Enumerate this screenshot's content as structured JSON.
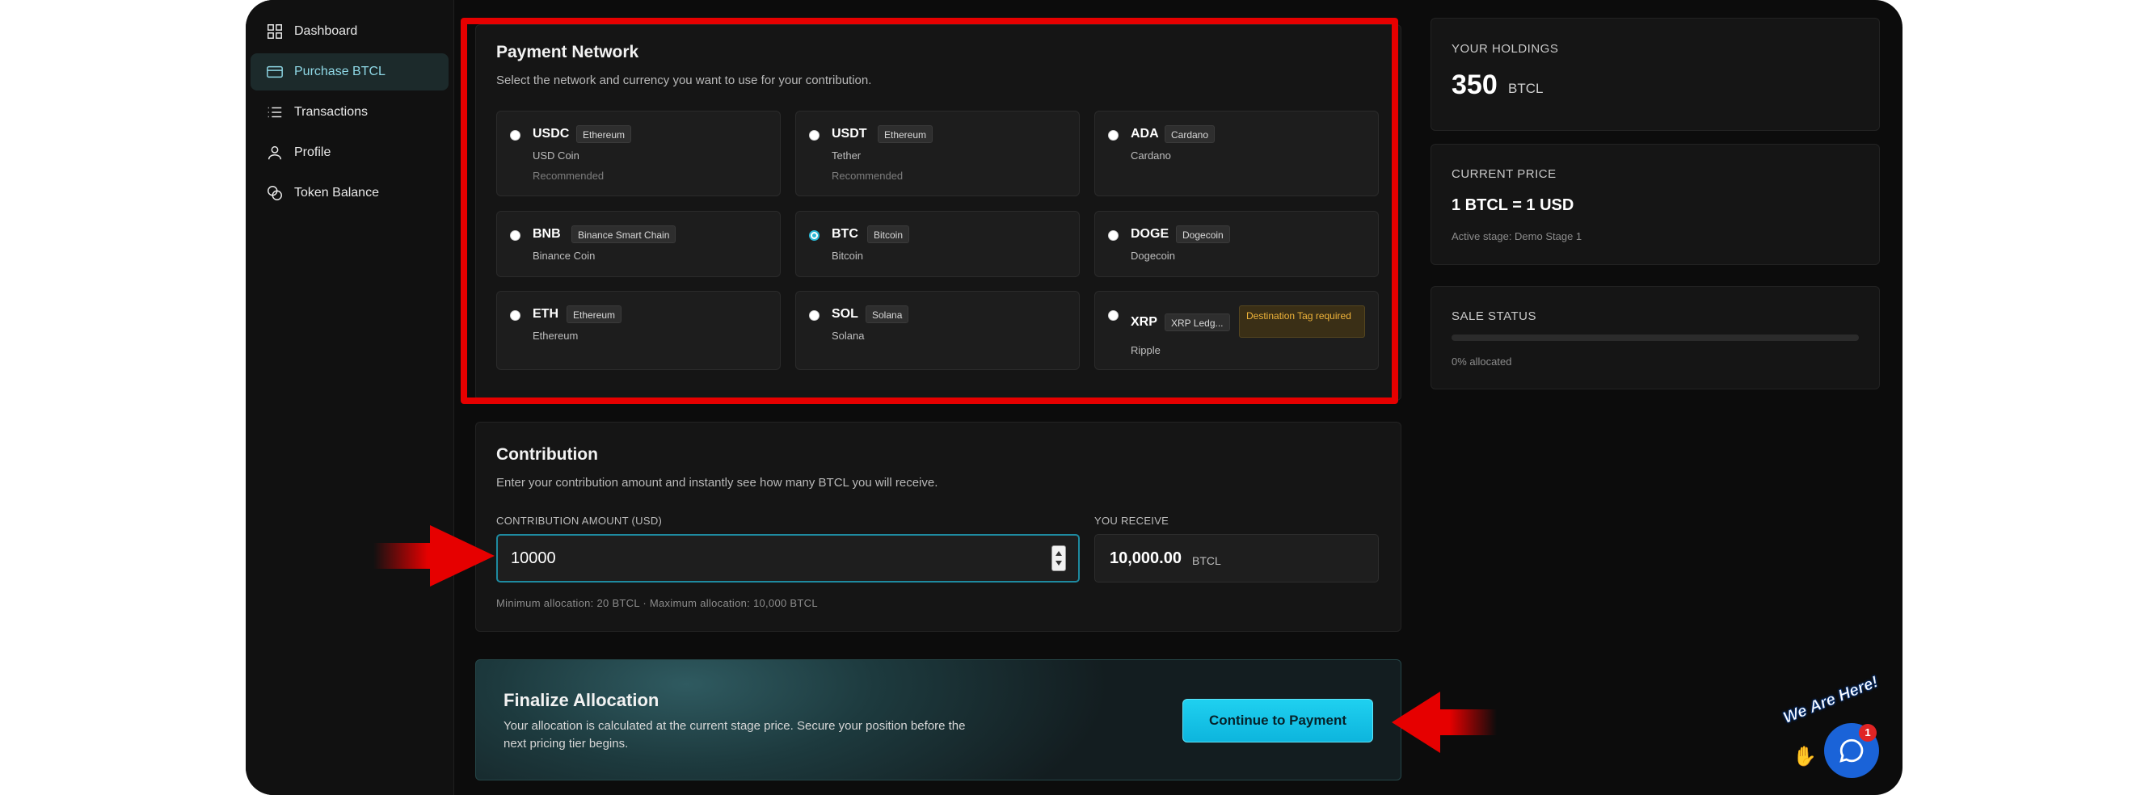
{
  "sidebar": {
    "items": [
      {
        "label": "Dashboard",
        "icon": "grid-icon",
        "active": false
      },
      {
        "label": "Purchase BTCL",
        "icon": "card-icon",
        "active": true
      },
      {
        "label": "Transactions",
        "icon": "list-icon",
        "active": false
      },
      {
        "label": "Profile",
        "icon": "user-icon",
        "active": false
      },
      {
        "label": "Token Balance",
        "icon": "coins-icon",
        "active": false
      }
    ]
  },
  "payment_network": {
    "title": "Payment Network",
    "subtitle": "Select the network and currency you want to use for your contribution.",
    "options": [
      {
        "symbol": "USDC",
        "chip": "Ethereum",
        "name": "USD Coin",
        "note": "Recommended",
        "selected": false
      },
      {
        "symbol": "USDT",
        "chip": "Ethereum",
        "name": "Tether",
        "note": "Recommended",
        "selected": false
      },
      {
        "symbol": "ADA",
        "chip": "Cardano",
        "name": "Cardano",
        "note": "",
        "selected": false
      },
      {
        "symbol": "BNB",
        "chip": "Binance Smart Chain",
        "name": "Binance Coin",
        "note": "",
        "selected": false
      },
      {
        "symbol": "BTC",
        "chip": "Bitcoin",
        "name": "Bitcoin",
        "note": "",
        "selected": true
      },
      {
        "symbol": "DOGE",
        "chip": "Dogecoin",
        "name": "Dogecoin",
        "note": "",
        "selected": false
      },
      {
        "symbol": "ETH",
        "chip": "Ethereum",
        "name": "Ethereum",
        "note": "",
        "selected": false
      },
      {
        "symbol": "SOL",
        "chip": "Solana",
        "name": "Solana",
        "note": "",
        "selected": false
      },
      {
        "symbol": "XRP",
        "chip": "XRP Ledg...",
        "name": "Ripple",
        "note": "",
        "warning": "Destination Tag required",
        "selected": false
      }
    ]
  },
  "contribution": {
    "title": "Contribution",
    "subtitle": "Enter your contribution amount and instantly see how many BTCL you will receive.",
    "amount_label": "CONTRIBUTION AMOUNT (USD)",
    "amount_value": "10000",
    "receive_label": "YOU RECEIVE",
    "receive_value": "10,000.00",
    "receive_unit": "BTCL",
    "limits": "Minimum allocation: 20 BTCL · Maximum allocation: 10,000 BTCL"
  },
  "finalize": {
    "title": "Finalize Allocation",
    "text_line1": "Your allocation is calculated at the current stage price. Secure your position before the",
    "text_line2": "next pricing tier begins.",
    "button": "Continue to Payment"
  },
  "holdings": {
    "label": "YOUR HOLDINGS",
    "value": "350",
    "unit": "BTCL"
  },
  "price": {
    "label": "CURRENT PRICE",
    "value": "1 BTCL = 1 USD",
    "stage": "Active stage: Demo Stage 1"
  },
  "sale": {
    "label": "SALE STATUS",
    "progress_fraction": 0,
    "allocated_text": "0% allocated"
  },
  "chat": {
    "banner": "We Are Here!",
    "badge": "1"
  },
  "colors": {
    "accent": "#1fc4e6",
    "highlight": "#e60000",
    "warning": "#f0b43a"
  }
}
